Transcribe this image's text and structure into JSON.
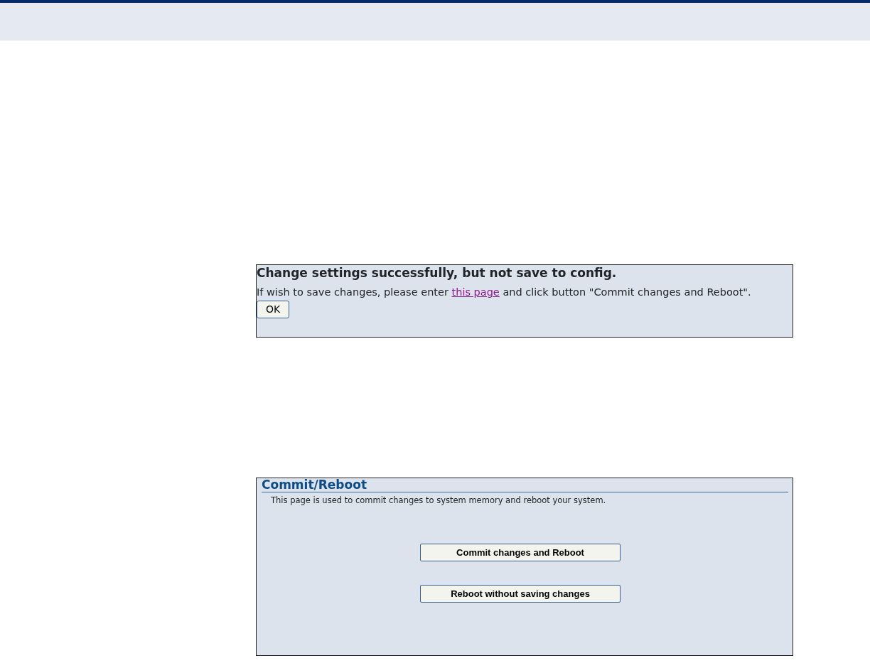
{
  "notice": {
    "heading": "Change settings successfully, but not save to config.",
    "message_before": "If wish to save changes, please enter ",
    "link": "this page",
    "message_after": " and click button \"Commit changes and Reboot\".",
    "button": "OK"
  },
  "commit_reboot": {
    "title": "Commit/Reboot",
    "description": "This page is used to commit changes to system memory and reboot your system.",
    "buttons": [
      "Commit changes and Reboot",
      "Reboot without saving changes"
    ]
  }
}
